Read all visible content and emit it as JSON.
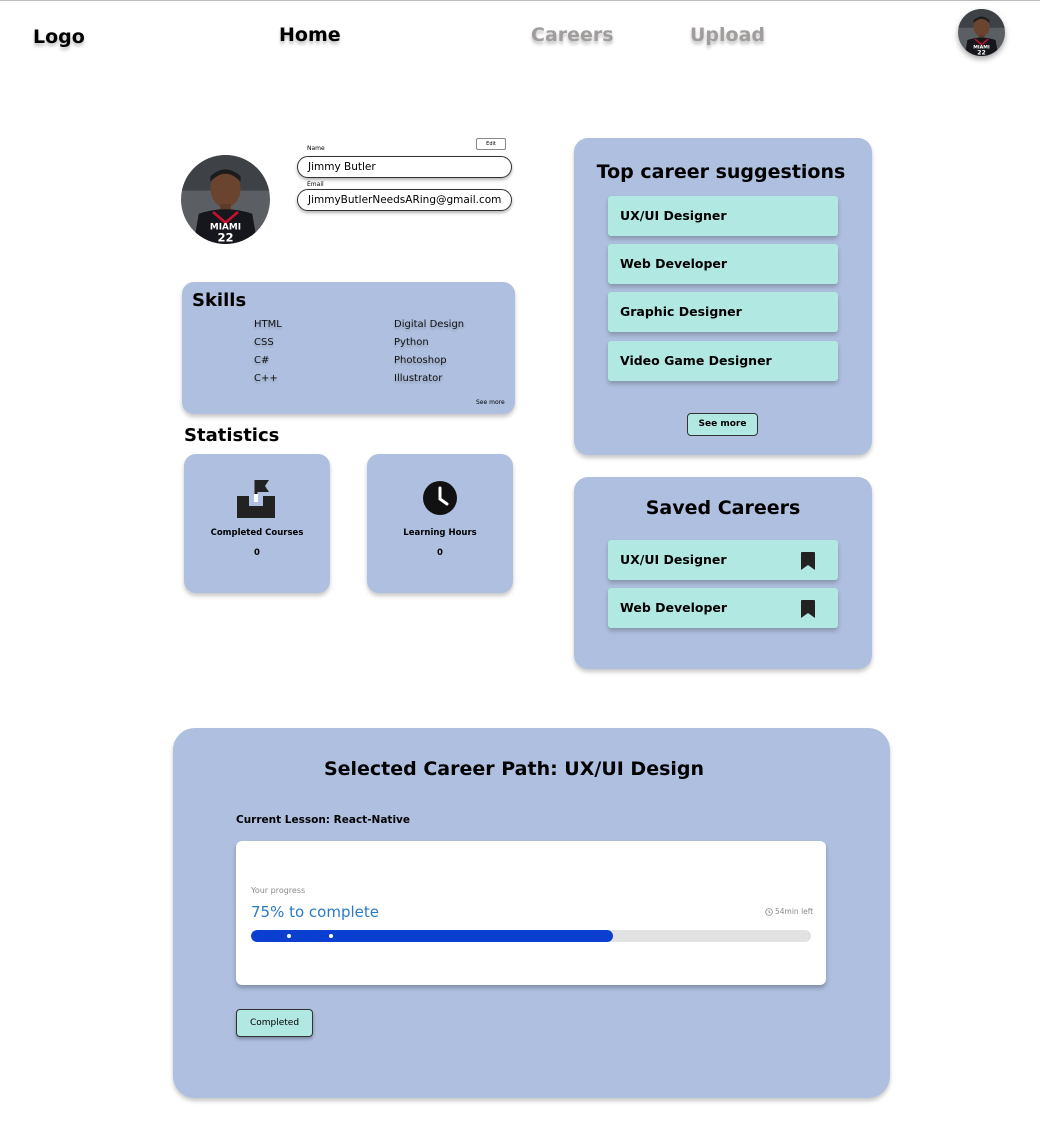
{
  "nav": {
    "logo": "Logo",
    "home": "Home",
    "careers": "Careers",
    "upload": "Upload",
    "avatar_icon": "user-avatar"
  },
  "profile": {
    "name_label": "Name",
    "name_value": "Jimmy Butler",
    "email_label": "Email",
    "email_value": "JimmyButlerNeedsARing@gmail.com",
    "edit_label": "Edit"
  },
  "skills": {
    "title": "Skills",
    "left_column": [
      "HTML",
      "CSS",
      "C#",
      "C++"
    ],
    "right_column": [
      "Digital Design",
      "Python",
      "Photoshop",
      "Illustrator"
    ],
    "see_more": "See more"
  },
  "statistics": {
    "title": "Statistics",
    "cards": [
      {
        "label": "Completed Courses",
        "value": "0",
        "icon": "flag-inbox-icon"
      },
      {
        "label": "Learning Hours",
        "value": "0",
        "icon": "clock-icon"
      }
    ]
  },
  "career_suggestions": {
    "title": "Top career suggestions",
    "items": [
      "UX/UI Designer",
      "Web Developer",
      "Graphic Designer",
      "Video Game Designer"
    ],
    "see_more": "See more"
  },
  "saved_careers": {
    "title": "Saved Careers",
    "items": [
      "UX/UI Designer",
      "Web Developer"
    ],
    "icon": "bookmark-icon"
  },
  "career_path": {
    "title": "Selected Career Path: UX/UI Design",
    "current_lesson": "Current Lesson: React-Native",
    "progress_label": "Your progress",
    "progress_text": "75%  to complete",
    "progress_fraction": 0.647,
    "time_left": "54min left",
    "completed_button": "Completed"
  },
  "colors": {
    "panel": "#aebfdf",
    "card": "#b2e8e2",
    "progress_fill": "#0a3fcf",
    "progress_text": "#2b7bc4",
    "nav_inactive": "#a19d9d"
  }
}
